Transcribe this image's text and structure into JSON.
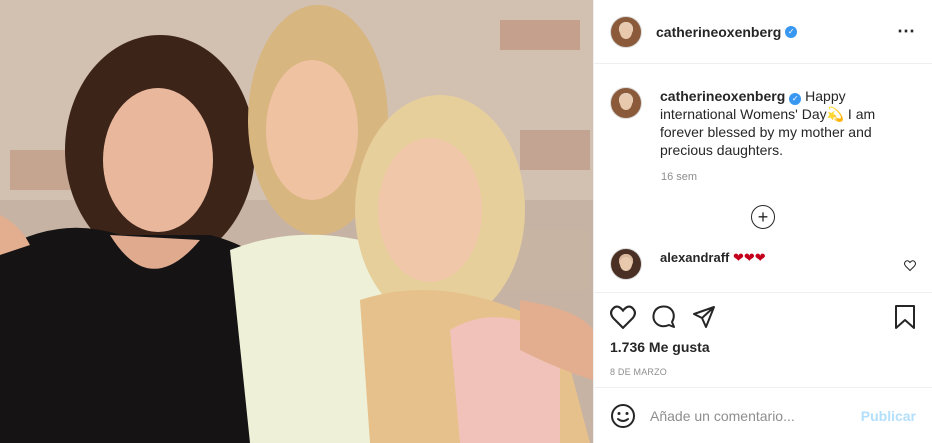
{
  "post": {
    "username": "catherineoxenberg",
    "more_icon": "⋯"
  },
  "caption": {
    "username": "catherineoxenberg",
    "text": "Happy international Womens' Day💫 I am forever blessed by my mother and precious daughters.",
    "time": "16 sem"
  },
  "reply": {
    "username": "alexandraff",
    "text": "❤❤❤"
  },
  "engagement": {
    "likes": "1.736 Me gusta",
    "date": "8 DE MARZO"
  },
  "comment_input": {
    "placeholder": "Añade un comentario...",
    "publish_label": "Publicar"
  },
  "colors": {
    "verified": "#3897f0",
    "publish_disabled": "#b2dffc",
    "heart": "#c4001d"
  },
  "icons": [
    "verified-badge-icon",
    "more-options-icon",
    "add-comments-icon",
    "heart-icon",
    "comment-icon",
    "share-icon",
    "save-icon",
    "emoji-icon",
    "like-comment-icon"
  ]
}
